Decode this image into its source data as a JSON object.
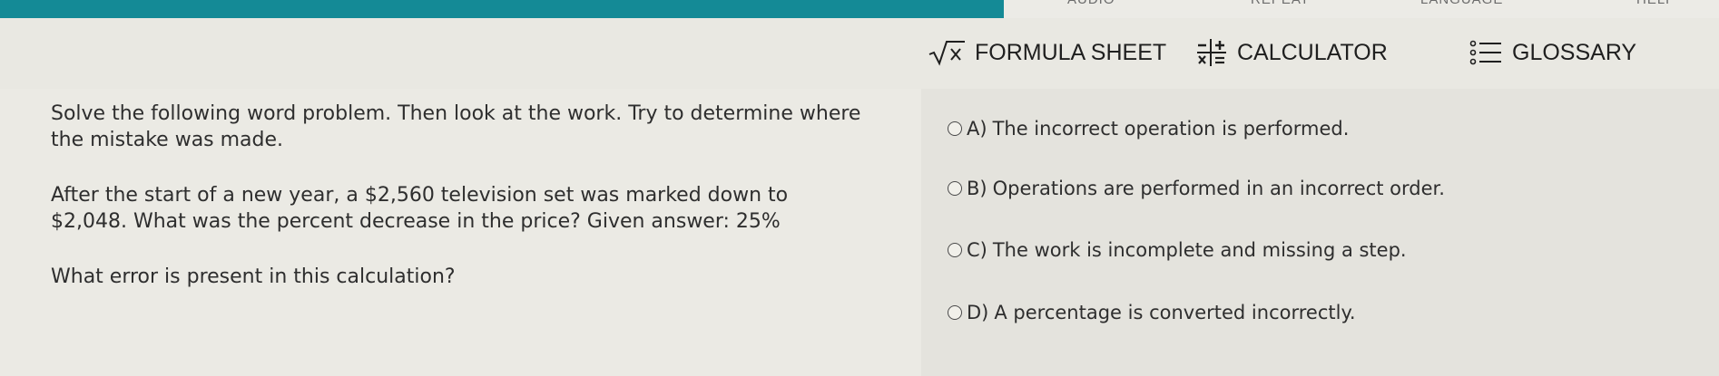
{
  "topbar": {
    "labels": [
      "AUDIO",
      "REPEAT",
      "LANGUAGE",
      "HELP"
    ],
    "accent_color": "#148a96"
  },
  "toolbar": {
    "formula_sheet": {
      "label": "FORMULA SHEET",
      "icon": "square-root-icon"
    },
    "calculator": {
      "label": "CALCULATOR",
      "icon": "calculator-operators-icon"
    },
    "glossary": {
      "label": "GLOSSARY",
      "icon": "list-icon"
    }
  },
  "question": {
    "instructions": "Solve the following word problem. Then look at the work. Try to determine where the mistake was made.",
    "problem": "After the start of a new year, a $2,560 television set was marked down to $2,048. What was the percent decrease in the price? Given answer: 25%",
    "prompt": "What error is present in this calculation?"
  },
  "options": [
    {
      "letter": "A)",
      "text": "The incorrect operation is performed."
    },
    {
      "letter": "B)",
      "text": "Operations are performed in an incorrect order."
    },
    {
      "letter": "C)",
      "text": "The work is incomplete and missing a step."
    },
    {
      "letter": "D)",
      "text": "A percentage is converted incorrectly."
    }
  ]
}
